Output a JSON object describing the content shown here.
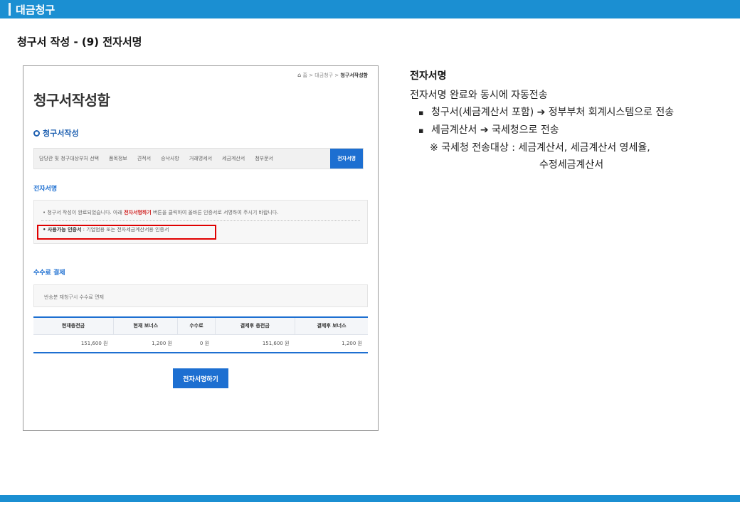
{
  "slide": {
    "title": "대금청구",
    "subtitle": "청구서 작성 - (9) 전자서명"
  },
  "screen": {
    "breadcrumb": {
      "home": "홈",
      "parent": "대금청구",
      "current": "청구서작성함"
    },
    "page_title": "청구서작성함",
    "section_title": "청구서작성",
    "steps": [
      "담당관 및 청구대상부처 선택",
      "품목정보",
      "견적서",
      "승낙사항",
      "거래명세서",
      "세금계산서",
      "첨부문서",
      "전자서명"
    ],
    "sub_heading": "전자서명",
    "notice_prefix": "• 청구서 작성이 완료되었습니다. 아래 ",
    "notice_highlight": "전자서명하기",
    "notice_suffix": " 버튼을 클릭하여 올바른 인증서로 서명하여 주시기 바랍니다.",
    "cert_label": "• 사용가능 인증서",
    "cert_value": " : 기업범용 또는 전자세금계산서용 인증서",
    "fee_heading": "수수료 결제",
    "fee_note": "반송분 재청구시 수수료 면제",
    "fee_table": {
      "headers": [
        "현재충전금",
        "현재 보너스",
        "수수료",
        "결제후 충전금",
        "결제후 보너스"
      ],
      "row": [
        "151,600 원",
        "1,200 원",
        "0 원",
        "151,600 원",
        "1,200 원"
      ]
    },
    "sign_button": "전자서명하기"
  },
  "explanation": {
    "heading": "전자서명",
    "line1": "전자서명 완료와 동시에 자동전송",
    "bullet1": "청구서(세금계산서 포함) ➔ 정부부처 회계시스템으로 전송",
    "bullet2": "세금계산서 ➔ 국세청으로 전송",
    "note1": "※ 국세청 전송대상 : 세금계산서, 세금계산서 영세율,",
    "note2": "수정세금계산서"
  },
  "colors": {
    "brand": "#1b8fd2",
    "active": "#1d6fd1",
    "highlight_red": "#e00000"
  }
}
